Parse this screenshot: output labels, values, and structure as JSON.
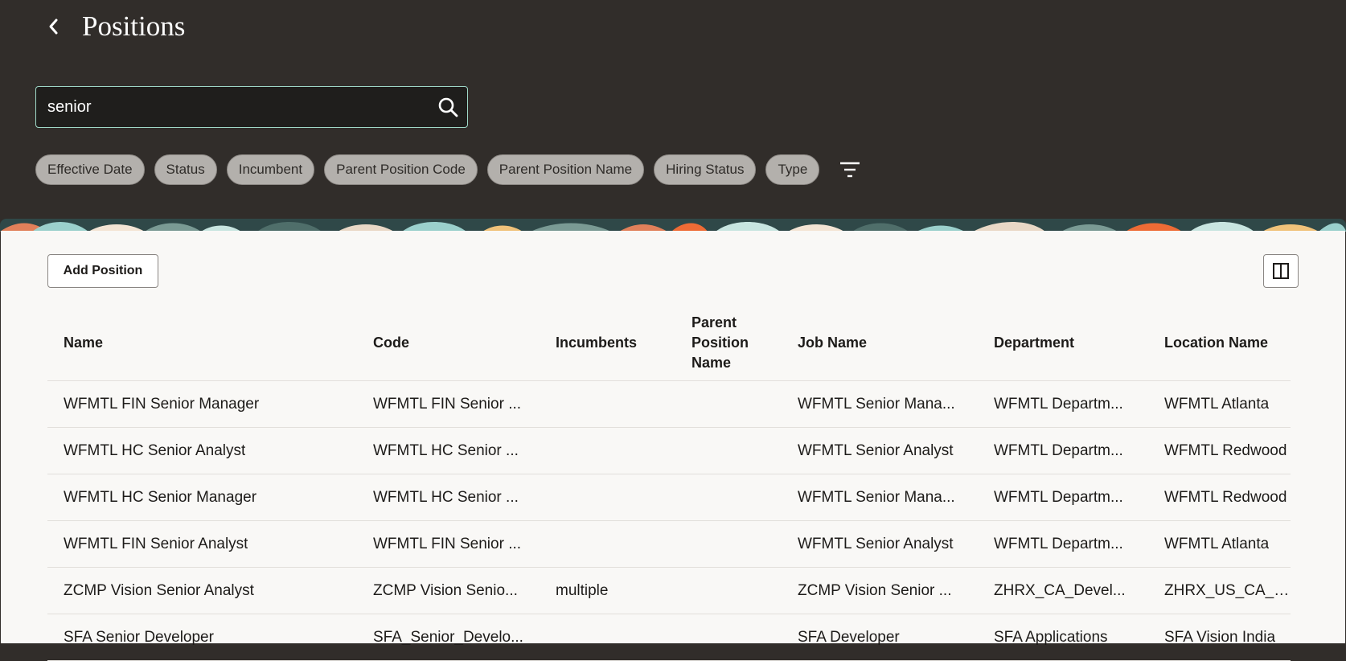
{
  "header": {
    "title": "Positions",
    "search": {
      "value": "senior",
      "placeholder": ""
    },
    "filters": [
      "Effective Date",
      "Status",
      "Incumbent",
      "Parent Position Code",
      "Parent Position Name",
      "Hiring Status",
      "Type"
    ]
  },
  "toolbar": {
    "add_label": "Add Position"
  },
  "table": {
    "headers": {
      "name": "Name",
      "code": "Code",
      "incumbents": "Incumbents",
      "parent_line1": "Parent",
      "parent_line2": "Position",
      "parent_line3": "Name",
      "job": "Job Name",
      "department": "Department",
      "location": "Location Name"
    },
    "rows": [
      {
        "name": "WFMTL FIN Senior Manager",
        "code": "WFMTL FIN Senior ...",
        "incumbents": "",
        "parent": "",
        "job": "WFMTL Senior Mana...",
        "department": "WFMTL Departm...",
        "location": "WFMTL Atlanta"
      },
      {
        "name": "WFMTL HC Senior Analyst",
        "code": "WFMTL HC Senior ...",
        "incumbents": "",
        "parent": "",
        "job": "WFMTL Senior Analyst",
        "department": "WFMTL Departm...",
        "location": "WFMTL Redwood"
      },
      {
        "name": "WFMTL HC Senior Manager",
        "code": "WFMTL HC Senior ...",
        "incumbents": "",
        "parent": "",
        "job": "WFMTL Senior Mana...",
        "department": "WFMTL Departm...",
        "location": "WFMTL Redwood"
      },
      {
        "name": "WFMTL FIN Senior Analyst",
        "code": "WFMTL FIN Senior ...",
        "incumbents": "",
        "parent": "",
        "job": "WFMTL Senior Analyst",
        "department": "WFMTL Departm...",
        "location": "WFMTL Atlanta"
      },
      {
        "name": "ZCMP Vision Senior Analyst",
        "code": "ZCMP Vision Senio...",
        "incumbents": "multiple",
        "parent": "",
        "job": "ZCMP Vision Senior ...",
        "department": "ZHRX_CA_Devel...",
        "location": "ZHRX_US_CA_LOC"
      },
      {
        "name": "SFA Senior Developer",
        "code": "SFA_Senior_Develo...",
        "incumbents": "",
        "parent": "",
        "job": "SFA Developer",
        "department": "SFA Applications",
        "location": "SFA Vision India"
      }
    ]
  },
  "icons": {
    "back": "chevron-left-icon",
    "search": "search-icon",
    "filter": "filter-icon",
    "columns": "columns-icon"
  },
  "colors": {
    "header_bg": "#312d2a",
    "search_border": "#9fd9c8",
    "chip_bg": "#b3b0ac",
    "panel_bg": "#f9f8f6"
  }
}
